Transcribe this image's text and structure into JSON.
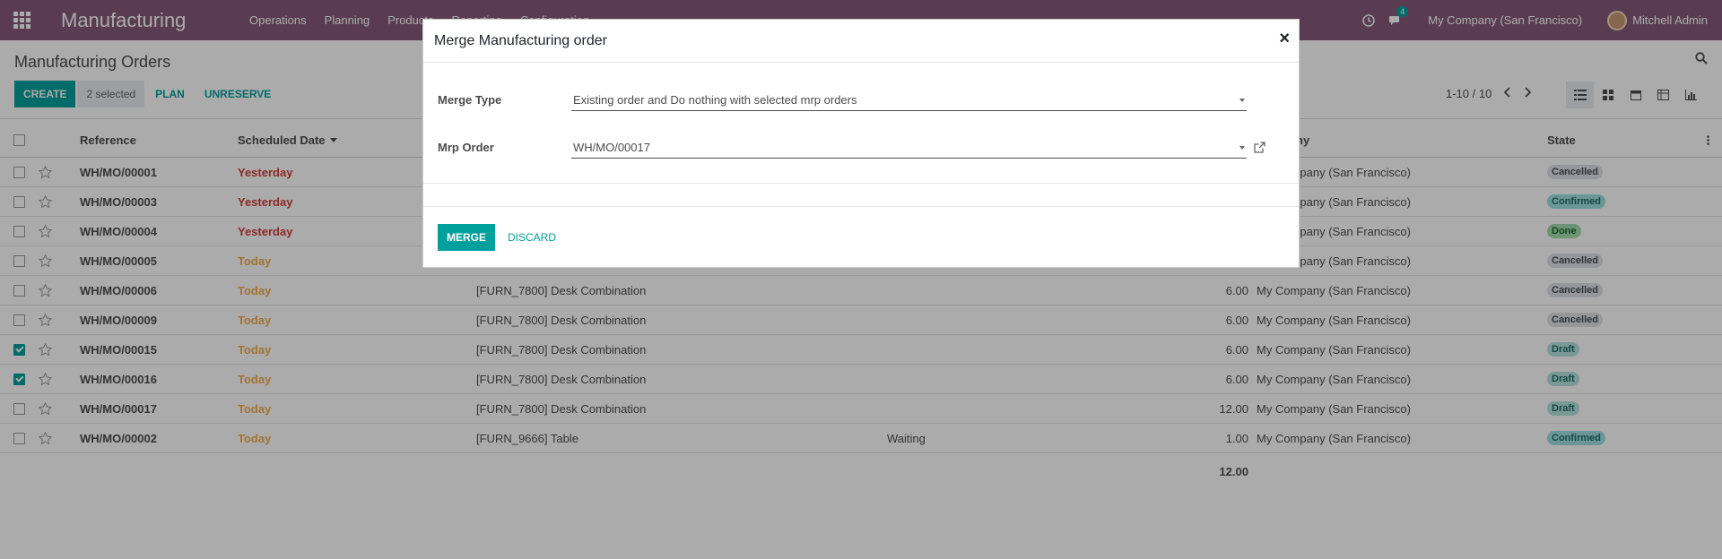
{
  "navbar": {
    "app_title": "Manufacturing",
    "menu": [
      "Operations",
      "Planning",
      "Products",
      "Reporting",
      "Configuration"
    ],
    "chat_badge": "4",
    "company": "My Company (San Francisco)",
    "user": "Mitchell Admin"
  },
  "control_panel": {
    "title": "Manufacturing Orders",
    "create_label": "CREATE",
    "selected_label": "2 selected",
    "plan_label": "PLAN",
    "unreserve_label": "UNRESERVE",
    "pager": "1-10 / 10"
  },
  "table": {
    "headers": {
      "reference": "Reference",
      "scheduled_date": "Scheduled Date",
      "company": "Company",
      "state": "State"
    },
    "rows": [
      {
        "ref": "WH/MO/00001",
        "date": "Yesterday",
        "date_type": "yest",
        "product": "",
        "status": "",
        "qty": "",
        "company": "My Company (San Francisco)",
        "state": "Cancelled",
        "state_type": "cancelled",
        "checked": false
      },
      {
        "ref": "WH/MO/00003",
        "date": "Yesterday",
        "date_type": "yest",
        "product": "",
        "status": "",
        "qty": "",
        "company": "My Company (San Francisco)",
        "state": "Confirmed",
        "state_type": "confirmed",
        "checked": false
      },
      {
        "ref": "WH/MO/00004",
        "date": "Yesterday",
        "date_type": "yest",
        "product": "",
        "status": "",
        "qty": "",
        "company": "My Company (San Francisco)",
        "state": "Done",
        "state_type": "done",
        "checked": false
      },
      {
        "ref": "WH/MO/00005",
        "date": "Today",
        "date_type": "today",
        "product": "",
        "status": "",
        "qty": "",
        "company": "My Company (San Francisco)",
        "state": "Cancelled",
        "state_type": "cancelled",
        "checked": false
      },
      {
        "ref": "WH/MO/00006",
        "date": "Today",
        "date_type": "today",
        "product": "[FURN_7800] Desk Combination",
        "status": "",
        "qty": "6.00",
        "company": "My Company (San Francisco)",
        "state": "Cancelled",
        "state_type": "cancelled",
        "checked": false
      },
      {
        "ref": "WH/MO/00009",
        "date": "Today",
        "date_type": "today",
        "product": "[FURN_7800] Desk Combination",
        "status": "",
        "qty": "6.00",
        "company": "My Company (San Francisco)",
        "state": "Cancelled",
        "state_type": "cancelled",
        "checked": false
      },
      {
        "ref": "WH/MO/00015",
        "date": "Today",
        "date_type": "today",
        "product": "[FURN_7800] Desk Combination",
        "status": "",
        "qty": "6.00",
        "company": "My Company (San Francisco)",
        "state": "Draft",
        "state_type": "draft",
        "checked": true
      },
      {
        "ref": "WH/MO/00016",
        "date": "Today",
        "date_type": "today",
        "product": "[FURN_7800] Desk Combination",
        "status": "",
        "qty": "6.00",
        "company": "My Company (San Francisco)",
        "state": "Draft",
        "state_type": "draft",
        "checked": true
      },
      {
        "ref": "WH/MO/00017",
        "date": "Today",
        "date_type": "today",
        "product": "[FURN_7800] Desk Combination",
        "status": "",
        "qty": "12.00",
        "company": "My Company (San Francisco)",
        "state": "Draft",
        "state_type": "draft",
        "checked": false
      },
      {
        "ref": "WH/MO/00002",
        "date": "Today",
        "date_type": "today",
        "product": "[FURN_9666] Table",
        "status": "Waiting",
        "qty": "1.00",
        "company": "My Company (San Francisco)",
        "state": "Confirmed",
        "state_type": "confirmed",
        "checked": false
      }
    ],
    "total_qty": "12.00"
  },
  "modal": {
    "title": "Merge Manufacturing order",
    "merge_type_label": "Merge Type",
    "merge_type_value": "Existing order and Do nothing with selected mrp orders",
    "mrp_order_label": "Mrp Order",
    "mrp_order_value": "WH/MO/00017",
    "merge_button": "MERGE",
    "discard_button": "DISCARD"
  },
  "colors": {
    "navbar": "#875a7b",
    "primary": "#00a09d",
    "danger": "#d23f3a",
    "warning": "#f0ad4e"
  }
}
